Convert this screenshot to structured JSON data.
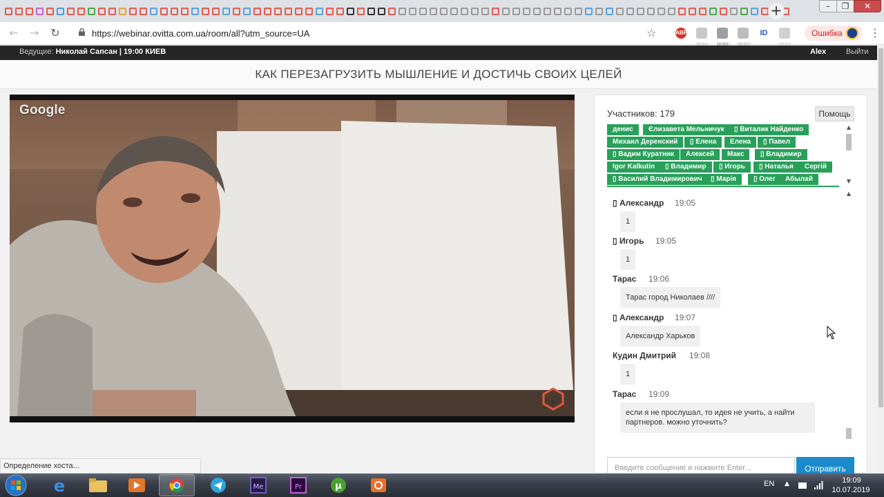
{
  "browser": {
    "url": "https://webinar.ovitta.com.ua/room/all?utm_source=UA",
    "error_label": "Ошибка",
    "new_tab_icon": "+",
    "window_controls": {
      "minimize": "–",
      "maximize": "❐",
      "close": "✕"
    },
    "extensions": [
      "ABP",
      "ext-gray-1",
      "ext-gray-2",
      "ext-gray-3",
      "ID",
      "ext-gray-4"
    ]
  },
  "header": {
    "host_label": "Ведущие: ",
    "host_value": "Николай Сапсан | 19:00 КИЕВ",
    "user_name": "Alex",
    "logout_label": "Выйти"
  },
  "webinar": {
    "title": "КАК ПЕРЕЗАГРУЗИТЬ МЫШЛЕНИЕ И ДОСТИЧЬ СВОИХ ЦЕЛЕЙ",
    "video_badge": "Google"
  },
  "chat": {
    "participants_label": "Участников: 179",
    "help_label": "Помощь",
    "participants": [
      "денис",
      "Єлизавета Мельничук",
      "▯ Виталик Найденко",
      "Михаил Деренский",
      "▯ Елена",
      "Елена",
      "▯ Павел",
      "▯ Вадим Куратник",
      "Алексей",
      "Макс",
      "▯ Владимир",
      "Igor Kalkutin",
      "▯ Владимир",
      "▯ Игорь",
      "▯ Наталья",
      "Сергій",
      "▯ Василий Владимирович",
      "▯ Марія",
      "▯ Олег",
      "Абылай"
    ],
    "messages": [
      {
        "author": "▯ Александр",
        "time": "19:05",
        "text": "1"
      },
      {
        "author": "▯ Игорь",
        "time": "19:05",
        "text": "1"
      },
      {
        "author": "Тарас",
        "time": "19:06",
        "text": "Тарас город Николаев ////"
      },
      {
        "author": "▯ Александр",
        "time": "19:07",
        "text": "Александр Харьков"
      },
      {
        "author": "Кудин Дмитрий",
        "time": "19:08",
        "text": "1"
      },
      {
        "author": "Тарас",
        "time": "19:09",
        "text": "если я не прослушал, то идея не учить, а найти партнеров. можно уточнить?"
      }
    ],
    "input_placeholder": "Введите сообщение и нажмите Enter...",
    "send_label": "Отправить"
  },
  "status": {
    "text": "Определение хоста..."
  },
  "taskbar": {
    "apps": [
      "Internet Explorer",
      "File Explorer",
      "Media Player",
      "Google Chrome",
      "Telegram",
      "Media Encoder",
      "Premiere Pro",
      "uTorrent",
      "Mail"
    ],
    "active_app": "Google Chrome",
    "language": "EN",
    "time": "19:09",
    "date": "10.07.2019"
  },
  "colors": {
    "participant_chip": "#28a05a",
    "send_button": "#1a8acb",
    "topbar": "#262626",
    "close_button": "#c94c4c"
  }
}
